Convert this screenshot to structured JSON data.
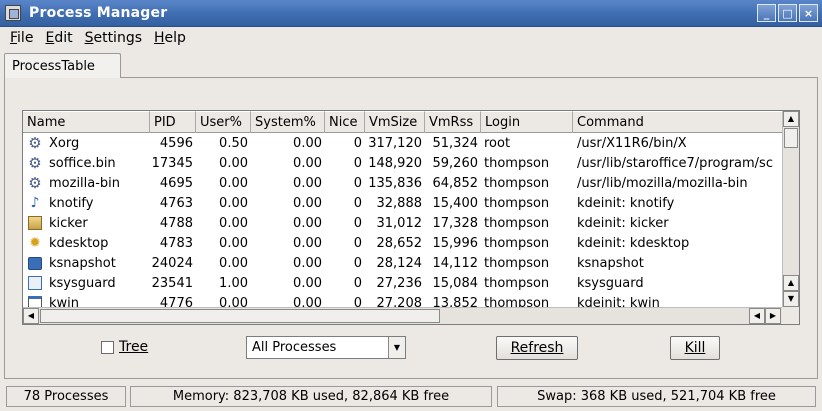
{
  "window": {
    "title": "Process Manager",
    "buttons": {
      "minimize": "_",
      "maximize": "□",
      "close": "×"
    }
  },
  "menu": [
    "File",
    "Edit",
    "Settings",
    "Help"
  ],
  "tabs": [
    "ProcessTable"
  ],
  "table": {
    "columns": [
      "Name",
      "PID",
      "User%",
      "System%",
      "Nice",
      "VmSize",
      "VmRss",
      "Login",
      "Command"
    ],
    "rows": [
      {
        "icon": "gear-icon",
        "cells": [
          "Xorg",
          "4596",
          "0.50",
          "0.00",
          "0",
          "317,120",
          "51,324",
          "root",
          "/usr/X11R6/bin/X"
        ]
      },
      {
        "icon": "gear-icon",
        "cells": [
          "soffice.bin",
          "17345",
          "0.00",
          "0.00",
          "0",
          "148,920",
          "59,260",
          "thompson",
          "/usr/lib/staroffice7/program/sc"
        ]
      },
      {
        "icon": "gear-icon",
        "cells": [
          "mozilla-bin",
          "4695",
          "0.00",
          "0.00",
          "0",
          "135,836",
          "64,852",
          "thompson",
          "/usr/lib/mozilla/mozilla-bin"
        ]
      },
      {
        "icon": "music-note-icon",
        "cells": [
          "knotify",
          "4763",
          "0.00",
          "0.00",
          "0",
          "32,888",
          "15,400",
          "thompson",
          "kdeinit: knotify"
        ]
      },
      {
        "icon": "kicker-panel-icon",
        "cells": [
          "kicker",
          "4788",
          "0.00",
          "0.00",
          "0",
          "31,012",
          "17,328",
          "thompson",
          "kdeinit: kicker"
        ]
      },
      {
        "icon": "desktop-sun-icon",
        "cells": [
          "kdesktop",
          "4783",
          "0.00",
          "0.00",
          "0",
          "28,652",
          "15,996",
          "thompson",
          "kdeinit: kdesktop"
        ]
      },
      {
        "icon": "camera-icon",
        "cells": [
          "ksnapshot",
          "24024",
          "0.00",
          "0.00",
          "0",
          "28,124",
          "14,112",
          "thompson",
          "ksnapshot"
        ]
      },
      {
        "icon": "system-monitor-icon",
        "cells": [
          "ksysguard",
          "23541",
          "1.00",
          "0.00",
          "0",
          "27,236",
          "15,084",
          "thompson",
          "ksysguard"
        ]
      },
      {
        "icon": "window-icon",
        "cells": [
          "kwin",
          "4776",
          "0.00",
          "0.00",
          "0",
          "27,208",
          "13,852",
          "thompson",
          "kdeinit: kwin"
        ]
      }
    ]
  },
  "controls": {
    "tree_label": "Tree",
    "filter_value": "All Processes",
    "refresh_label": "Refresh",
    "kill_label": "Kill"
  },
  "status": {
    "processes": "78 Processes",
    "memory": "Memory: 823,708 KB used, 82,864 KB free",
    "swap": "Swap: 368 KB used, 521,704 KB free"
  }
}
